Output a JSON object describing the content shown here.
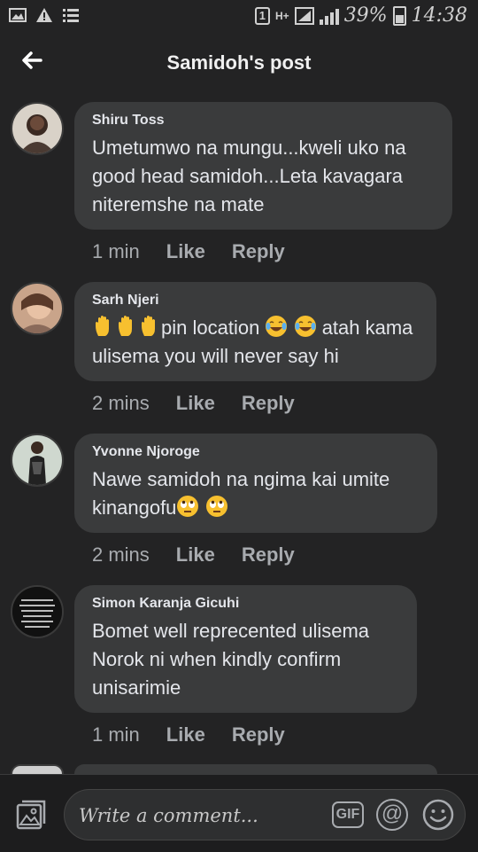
{
  "status_bar": {
    "sim": "1",
    "network": "H+",
    "battery": "39%",
    "time": "14:38"
  },
  "header": {
    "title": "Samidoh's post"
  },
  "comments": [
    {
      "author": "Shiru Toss",
      "text": "Umetumwo na mungu...kweli uko na good head samidoh...Leta kavagara niteremshe na mate",
      "time": "1 min",
      "like_label": "Like",
      "reply_label": "Reply"
    },
    {
      "author": "Sarh Njeri",
      "text_part1": "pin location",
      "text_part2": "atah kama ulisema you will never say hi",
      "time": "2 mins",
      "like_label": "Like",
      "reply_label": "Reply"
    },
    {
      "author": "Yvonne Njoroge",
      "text": "Nawe samidoh na ngima kai umite kinangofu",
      "time": "2 mins",
      "like_label": "Like",
      "reply_label": "Reply"
    },
    {
      "author": "Simon Karanja Gicuhi",
      "text": "Bomet well reprecented ulisema Norok ni when kindly confirm unisarimie",
      "time": "1 min",
      "like_label": "Like",
      "reply_label": "Reply"
    }
  ],
  "composer": {
    "placeholder": "Write a comment...",
    "gif_label": "GIF",
    "at_label": "@"
  }
}
